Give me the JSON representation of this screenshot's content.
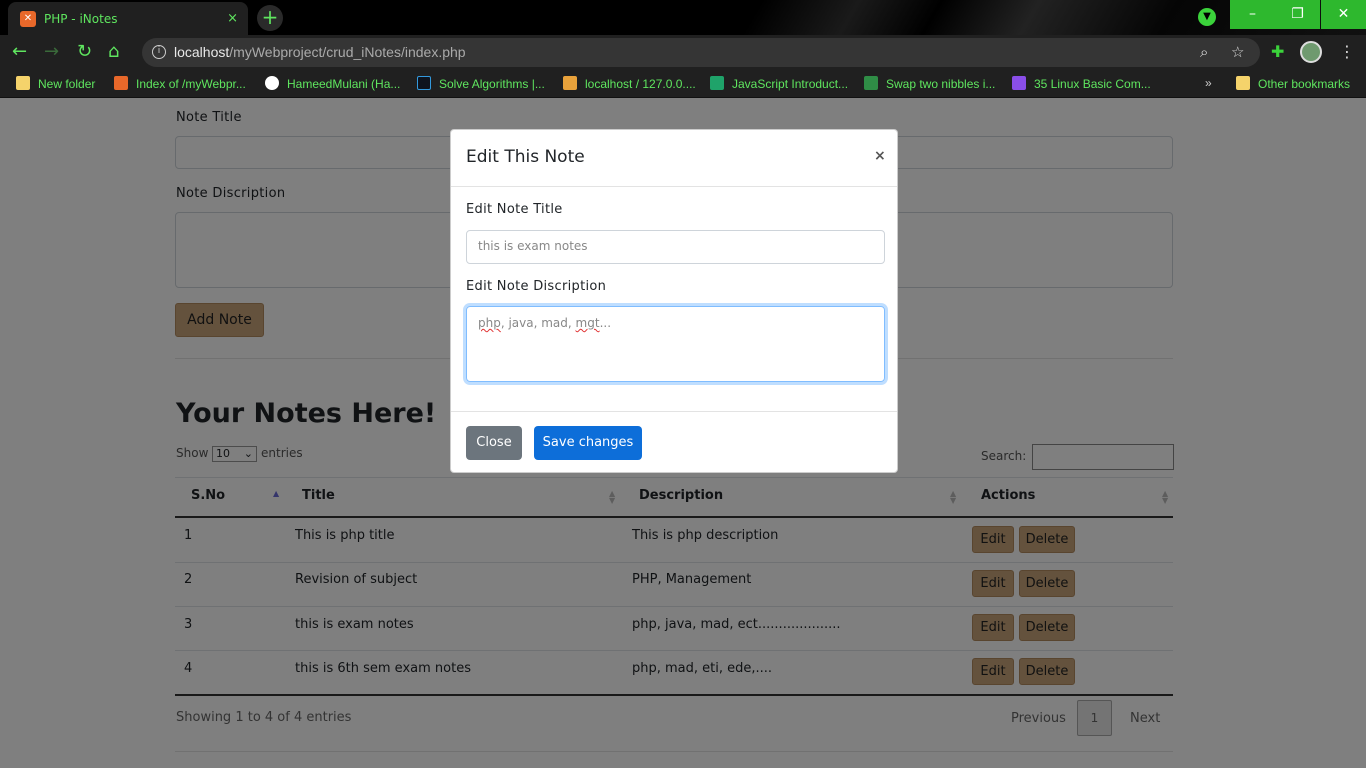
{
  "browser": {
    "tab_title": "PHP - iNotes",
    "tab_close": "×",
    "new_tab": "+",
    "url_host": "localhost",
    "url_path": "/myWebproject/crud_iNotes/index.php",
    "bookmarks": [
      "New folder",
      "Index of /myWebpr...",
      "HameedMulani (Ha...",
      "Solve Algorithms |...",
      "localhost / 127.0.0....",
      "JavaScript Introduct...",
      "Swap two nibbles i...",
      "35 Linux Basic Com..."
    ],
    "bookmarks_overflow": "»",
    "other_bookmarks": "Other bookmarks",
    "window_controls": {
      "minimize": "–",
      "maximize": "❐",
      "close": "✕"
    }
  },
  "form": {
    "title_label": "Note Title",
    "description_label": "Note Discription",
    "add_button": "Add Note"
  },
  "notes": {
    "heading": "Your Notes Here!",
    "show_label": "Show",
    "page_size": "10",
    "entries_label": "entries",
    "search_label": "Search:",
    "columns": [
      "S.No",
      "Title",
      "Description",
      "Actions"
    ],
    "rows": [
      {
        "sno": "1",
        "title": "This is php title",
        "description": "This is php description"
      },
      {
        "sno": "2",
        "title": "Revision of subject",
        "description": "PHP, Management"
      },
      {
        "sno": "3",
        "title": "this is exam notes",
        "description": "php, java, mad, ect...................."
      },
      {
        "sno": "4",
        "title": "this is 6th sem exam notes",
        "description": "php, mad, eti, ede,...."
      }
    ],
    "edit_label": "Edit",
    "delete_label": "Delete",
    "info": "Showing 1 to 4 of 4 entries",
    "previous": "Previous",
    "current_page": "1",
    "next": "Next"
  },
  "modal": {
    "title": "Edit This Note",
    "close_x": "×",
    "title_label": "Edit Note Title",
    "title_value": "this is exam notes",
    "description_label": "Edit Note Discription",
    "description_word1": "php",
    "description_mid": ", java, mad, ",
    "description_word2": "mgt",
    "description_end": "...",
    "close_button": "Close",
    "save_button": "Save changes"
  }
}
